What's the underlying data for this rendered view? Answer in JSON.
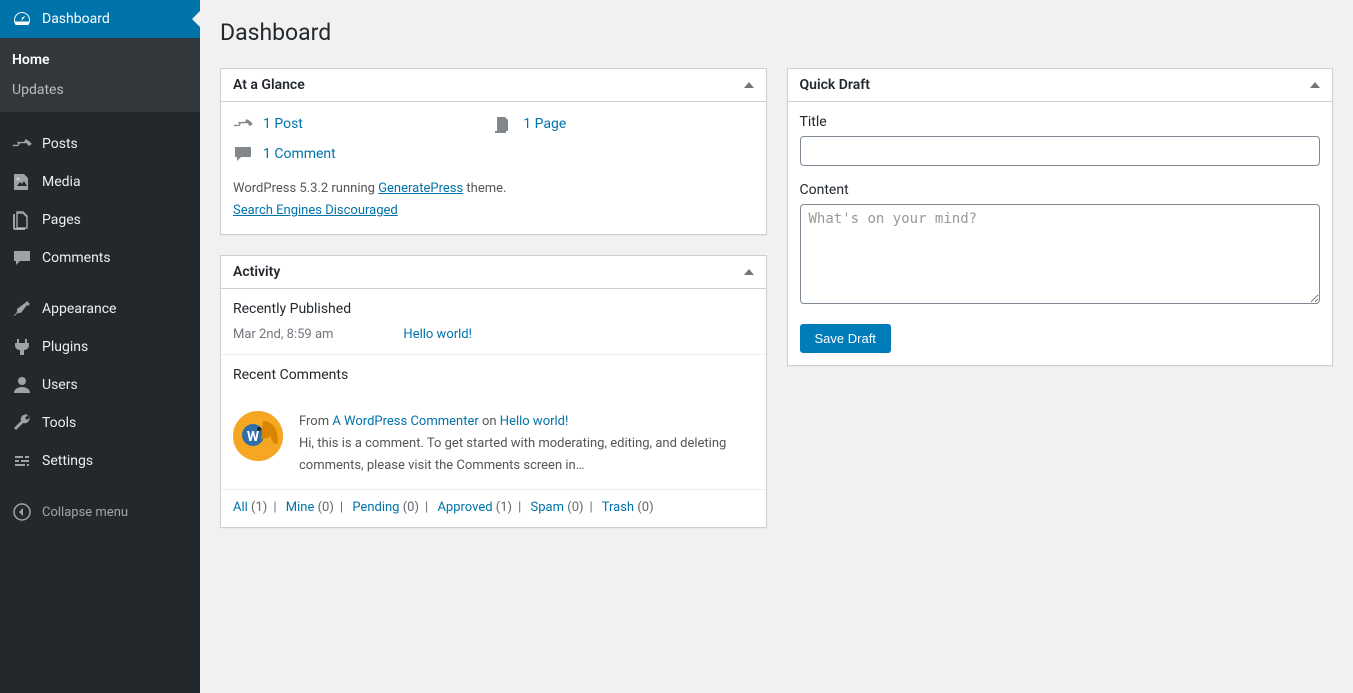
{
  "sidebar": {
    "dashboard": "Dashboard",
    "home": "Home",
    "updates": "Updates",
    "posts": "Posts",
    "media": "Media",
    "pages": "Pages",
    "comments": "Comments",
    "appearance": "Appearance",
    "plugins": "Plugins",
    "users": "Users",
    "tools": "Tools",
    "settings": "Settings",
    "collapse": "Collapse menu"
  },
  "page": {
    "title": "Dashboard"
  },
  "glance": {
    "title": "At a Glance",
    "post": "1 Post",
    "page": "1 Page",
    "comment": "1 Comment",
    "wp_version_prefix": "WordPress 5.3.2 running ",
    "theme": "GeneratePress",
    "theme_suffix": " theme.",
    "search_engines": "Search Engines Discouraged"
  },
  "activity": {
    "title": "Activity",
    "recently_published": "Recently Published",
    "pub_date": "Mar 2nd, 8:59 am",
    "pub_link": "Hello world!",
    "recent_comments": "Recent Comments",
    "comment_from": "From ",
    "comment_author": "A WordPress Commenter",
    "comment_on": " on ",
    "comment_post": "Hello world!",
    "comment_text": "Hi, this is a comment. To get started with moderating, editing, and deleting comments, please visit the Comments screen in…",
    "filters": {
      "all": "All",
      "all_c": "(1)",
      "mine": "Mine",
      "mine_c": "(0)",
      "pending": "Pending",
      "pending_c": "(0)",
      "approved": "Approved",
      "approved_c": "(1)",
      "spam": "Spam",
      "spam_c": "(0)",
      "trash": "Trash",
      "trash_c": "(0)"
    }
  },
  "draft": {
    "title": "Quick Draft",
    "title_label": "Title",
    "content_label": "Content",
    "placeholder": "What's on your mind?",
    "save": "Save Draft"
  }
}
